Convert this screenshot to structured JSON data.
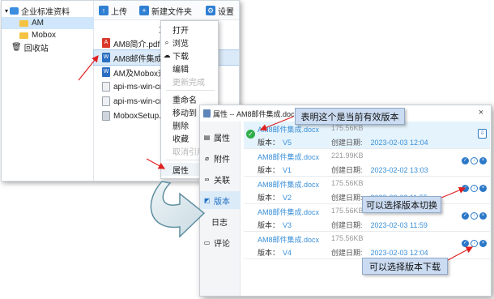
{
  "tree": {
    "items": [
      {
        "label": "企业标准资料",
        "icon": "cloud-folder-icon"
      },
      {
        "label": "AM",
        "icon": "folder-icon"
      },
      {
        "label": "Mobox",
        "icon": "folder-icon"
      },
      {
        "label": "回收站",
        "icon": "trash-icon"
      }
    ]
  },
  "toolbar": {
    "upload_label": "上传",
    "new_folder_label": "新建文件夹",
    "settings_label": "设置"
  },
  "filelist": {
    "header": "文",
    "files": [
      {
        "name": "AM8简介.pdf",
        "type": "pdf"
      },
      {
        "name": "AM8邮件集成.d",
        "type": "docx"
      },
      {
        "name": "AM及Mobox升",
        "type": "docx"
      },
      {
        "name": "api-ms-win-crt-",
        "type": "dll"
      },
      {
        "name": "api-ms-win-crt-",
        "type": "dll"
      },
      {
        "name": "MoboxSetup.ex",
        "type": "exe"
      }
    ]
  },
  "context_menu": {
    "items": [
      {
        "label": "打开",
        "icon": ""
      },
      {
        "label": "浏览",
        "icon": "search-icon"
      },
      {
        "label": "下载",
        "icon": "cloud-download-icon"
      },
      {
        "label": "编辑",
        "icon": ""
      },
      {
        "label": "更新完成",
        "icon": ""
      },
      {
        "label": "重命名",
        "icon": ""
      },
      {
        "label": "移动到",
        "icon": ""
      },
      {
        "label": "删除",
        "icon": ""
      },
      {
        "label": "收藏",
        "icon": ""
      },
      {
        "label": "取消引用",
        "icon": ""
      },
      {
        "label": "属性",
        "icon": ""
      }
    ]
  },
  "dialog": {
    "title": "属性 -- AM8邮件集成.docx",
    "close": "×",
    "tabs": [
      {
        "label": "属性",
        "icon": "properties-icon"
      },
      {
        "label": "附件",
        "icon": "paperclip-icon"
      },
      {
        "label": "关联",
        "icon": "link-icon"
      },
      {
        "label": "版本",
        "icon": "version-icon"
      },
      {
        "label": "日志",
        "icon": "log-icon"
      },
      {
        "label": "评论",
        "icon": "comment-icon"
      }
    ],
    "version_label": "版本：",
    "date_label": "创建日期:",
    "versions": [
      {
        "name": "AM8邮件集成.docx",
        "size": "175.56KB",
        "version": "V5",
        "date": "2023-02-03 12:04",
        "current": true
      },
      {
        "name": "AM8邮件集成.docx",
        "size": "221.99KB",
        "version": "V1",
        "date": "2023-02-02 13:03",
        "current": false
      },
      {
        "name": "AM8邮件集成.docx",
        "size": "175.56KB",
        "version": "V2",
        "date": "2023-02-03 11:55",
        "current": false
      },
      {
        "name": "AM8邮件集成.docx",
        "size": "175.56KB",
        "version": "V3",
        "date": "2023-02-03 11:59",
        "current": false
      },
      {
        "name": "AM8邮件集成.docx",
        "size": "175.56KB",
        "version": "V4",
        "date": "2023-02-03 12:04",
        "current": false
      }
    ]
  },
  "callouts": {
    "current_version": "表明这个是当前有效版本",
    "switch_version": "可以选择版本切换",
    "download_version": "可以选择版本下载"
  },
  "colors": {
    "accent": "#2b78c8",
    "link": "#3a8fd8",
    "current_check": "#2fae4a",
    "arrow_red": "#e02020",
    "callout_bg": "#cbdcf2"
  }
}
